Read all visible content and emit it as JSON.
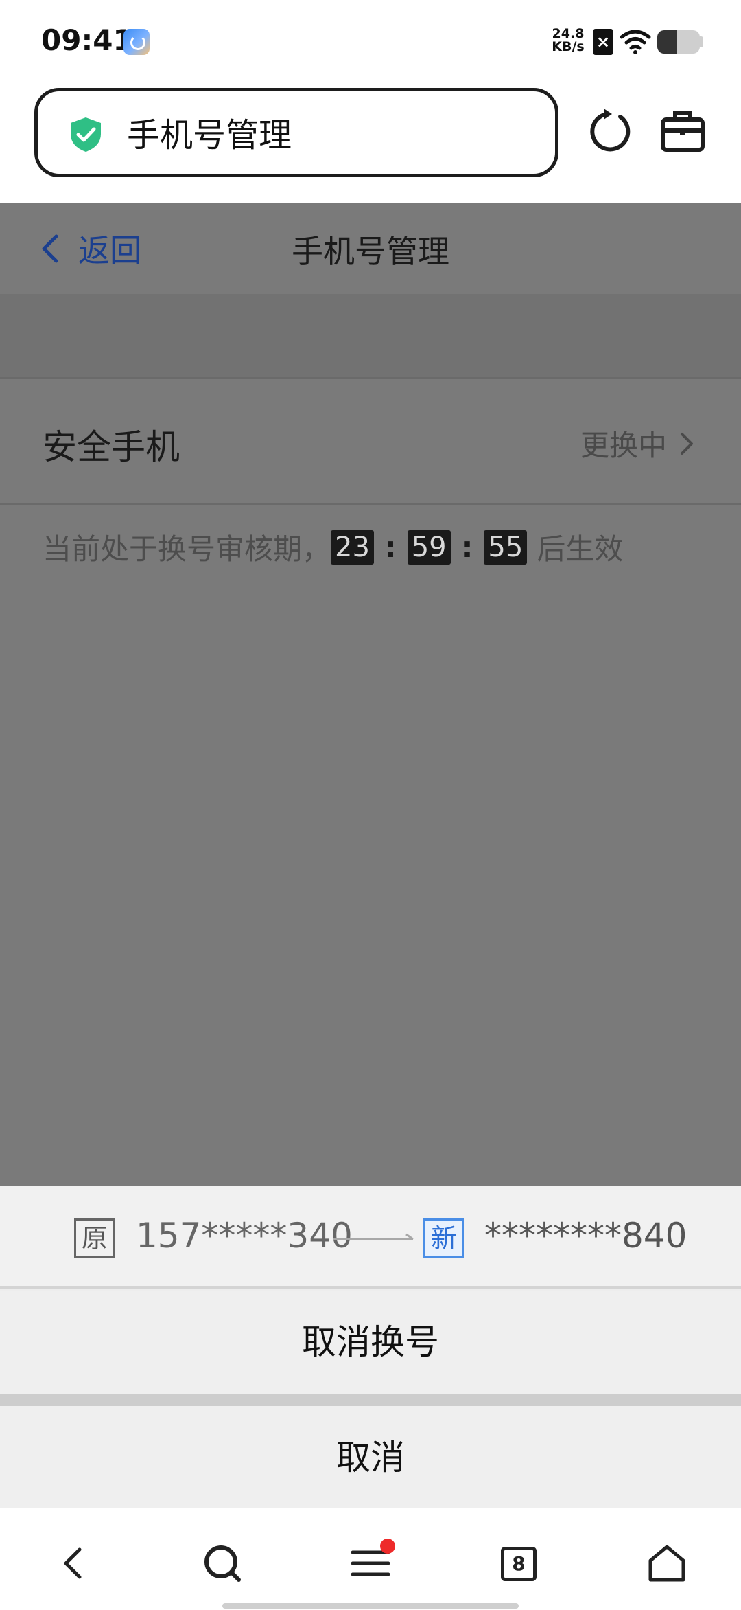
{
  "status_bar": {
    "time": "09:41",
    "net_speed_value": "24.8",
    "net_speed_unit": "KB/s",
    "sim_icon": "x-signal-icon",
    "battery_level": 0.45
  },
  "browser": {
    "url_title": "手机号管理",
    "shield_color": "#2fbf85"
  },
  "page": {
    "back_label": "返回",
    "title": "手机号管理",
    "row_label": "安全手机",
    "row_status": "更换中",
    "countdown_prefix": "当前处于换号审核期，",
    "countdown_hours": "23",
    "countdown_minutes": "59",
    "countdown_seconds": "55",
    "countdown_separator": ":",
    "countdown_suffix": "后生效"
  },
  "sheet": {
    "old_tag": "原",
    "old_number": "157*****340",
    "new_tag": "新",
    "new_number": "********840",
    "cancel_change_label": "取消换号",
    "cancel_label": "取消"
  },
  "bottom_nav": {
    "tabs_count": "8"
  },
  "colors": {
    "link_blue": "#1b3f8f",
    "new_tag_blue": "#2c6fd6",
    "notification_red": "#ee2a2a",
    "overlay_gray": "#7a7a7a"
  }
}
